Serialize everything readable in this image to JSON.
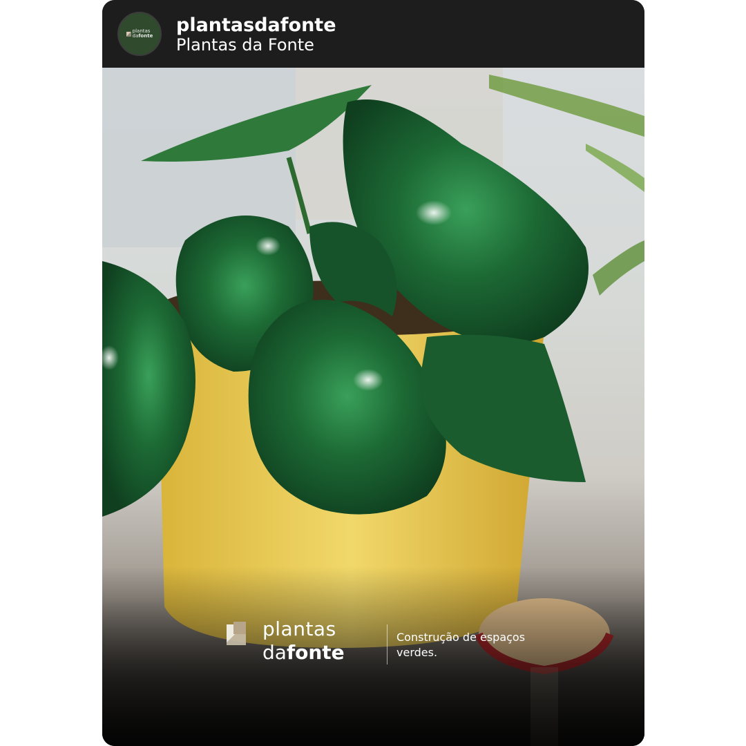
{
  "post": {
    "account_handle": "plantasdafonte",
    "account_name": "Plantas da Fonte",
    "avatar": {
      "line1": "plantas",
      "line2_light": "da",
      "line2_bold": "fonte"
    }
  },
  "overlay": {
    "brand_line1": "plantas",
    "brand_line2_light": "da",
    "brand_line2_bold": "fonte",
    "tagline": "Construção de espaços verdes."
  },
  "colors": {
    "header_bg": "#1d1d1d",
    "avatar_bg": "#2f4a2c",
    "leaf": "#1f6a34",
    "pot": "#e6c84a"
  }
}
